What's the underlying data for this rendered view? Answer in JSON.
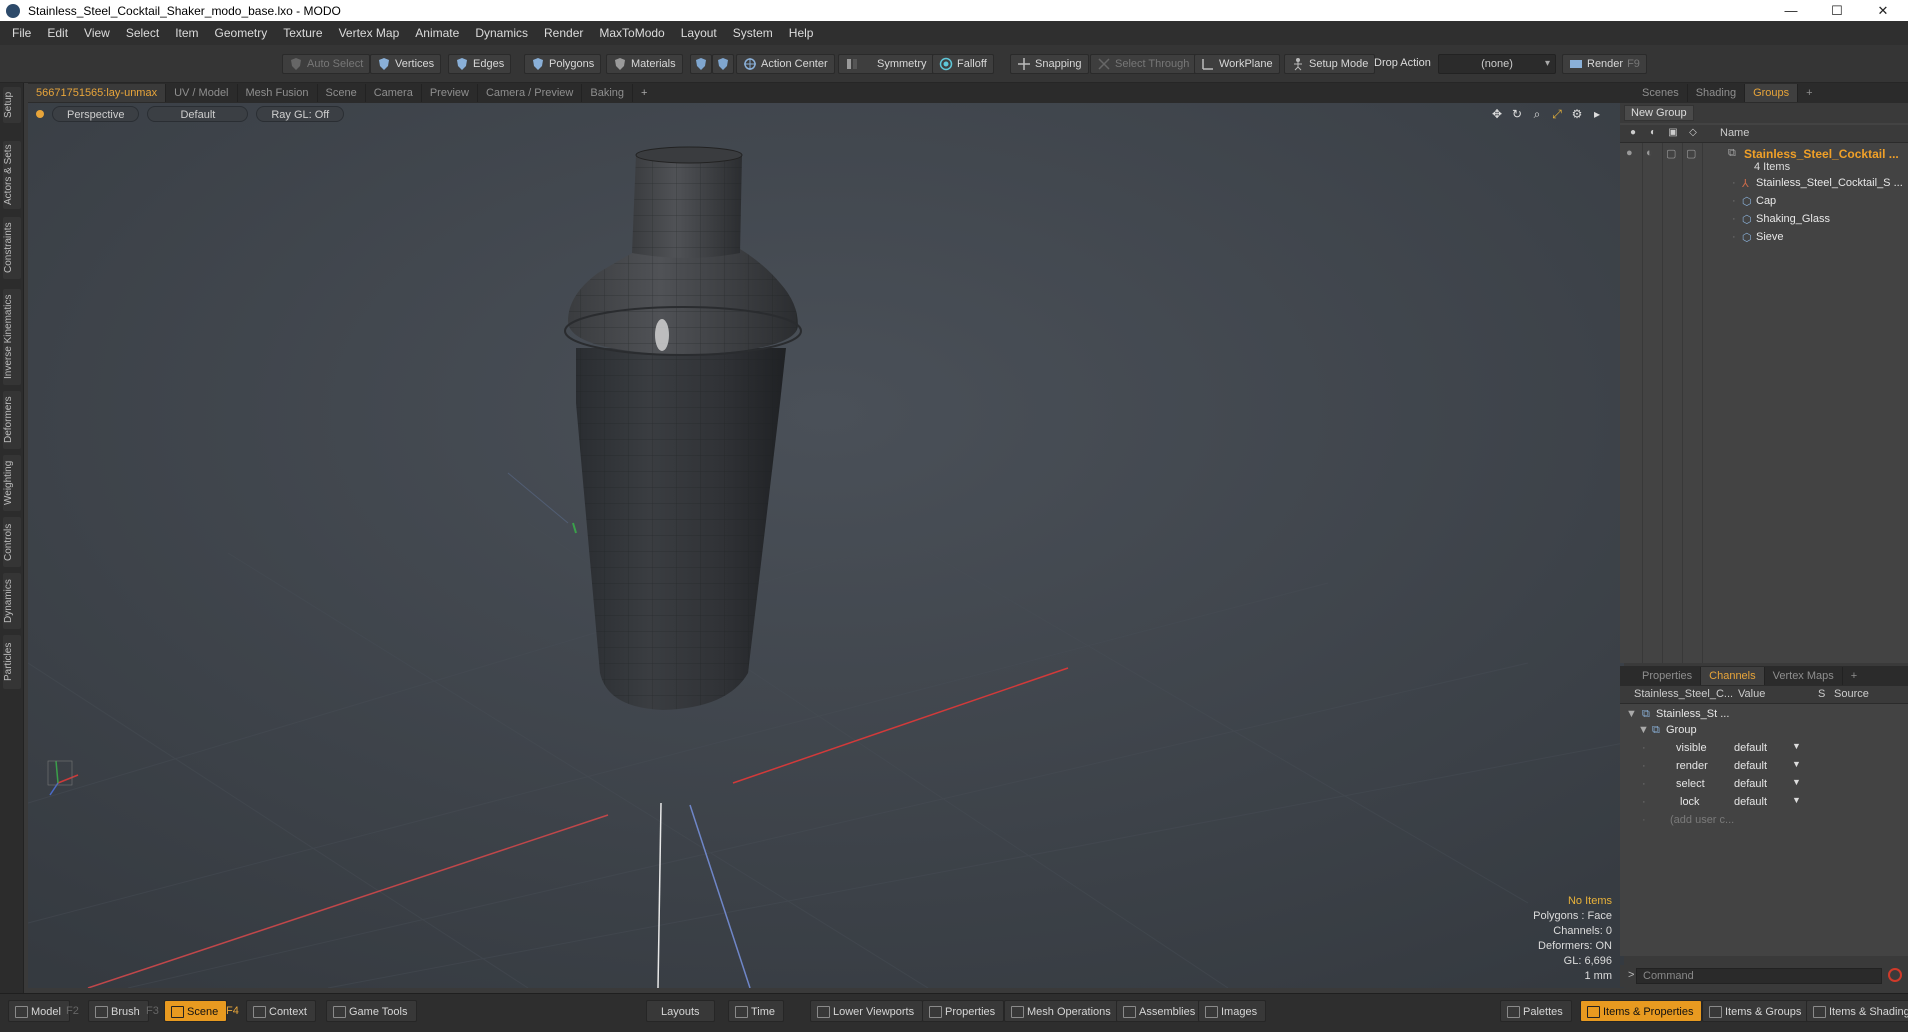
{
  "window": {
    "title": "Stainless_Steel_Cocktail_Shaker_modo_base.lxo - MODO",
    "minimize": "—",
    "maximize": "☐",
    "close": "✕"
  },
  "menu": [
    "File",
    "Edit",
    "View",
    "Select",
    "Item",
    "Geometry",
    "Texture",
    "Vertex Map",
    "Animate",
    "Dynamics",
    "Render",
    "MaxToModo",
    "Layout",
    "System",
    "Help"
  ],
  "toolbar": {
    "auto_select": "Auto Select",
    "vertices": "Vertices",
    "edges": "Edges",
    "polygons": "Polygons",
    "materials": "Materials",
    "action_center": "Action Center",
    "symmetry": "Symmetry",
    "falloff": "Falloff",
    "snapping": "Snapping",
    "select_through": "Select Through",
    "workplane": "WorkPlane",
    "setup_mode": "Setup Mode",
    "drop_action_label": "Drop Action",
    "drop_action_value": "(none)",
    "render": "Render",
    "render_key": "F9"
  },
  "left_tabs": [
    "Setup",
    "Actors & Sets",
    "Constraints",
    "Inverse Kinematics",
    "Deformers",
    "Weighting",
    "Controls",
    "Dynamics",
    "Particles"
  ],
  "viewport_tabs": [
    "56671751565:lay-unmax",
    "UV / Model",
    "Mesh Fusion",
    "Scene",
    "Camera",
    "Preview",
    "Camera / Preview",
    "Baking",
    "+"
  ],
  "viewport": {
    "view_mode": "Perspective",
    "shading": "Default",
    "raygl": "Ray GL: Off",
    "info": {
      "items": "No Items",
      "polygons": "Polygons : Face",
      "channels": "Channels: 0",
      "deformers": "Deformers: ON",
      "gl": "GL: 6,696",
      "unit": "1 mm"
    }
  },
  "scene_panel": {
    "tabs": [
      "Scenes",
      "Shading",
      "Groups",
      "+"
    ],
    "new_group": "New Group",
    "name_header": "Name",
    "group_name": "Stainless_Steel_Cocktail ...",
    "group_count": "4 Items",
    "items": [
      "Stainless_Steel_Cocktail_S ...",
      "Cap",
      "Shaking_Glass",
      "Sieve"
    ]
  },
  "channels_panel": {
    "tabs": [
      "Properties",
      "Channels",
      "Vertex Maps",
      "+"
    ],
    "headers": {
      "name": "Stainless_Steel_C...",
      "value": "Value",
      "s": "S",
      "source": "Source"
    },
    "root": "Stainless_St ...",
    "group": "Group",
    "rows": [
      {
        "name": "visible",
        "value": "default"
      },
      {
        "name": "render",
        "value": "default"
      },
      {
        "name": "select",
        "value": "default"
      },
      {
        "name": "lock",
        "value": "default"
      }
    ],
    "add_user": "(add user c..."
  },
  "command": {
    "prompt": ">",
    "placeholder": "Command"
  },
  "bottom": {
    "model": "Model",
    "model_key": "F2",
    "brush": "Brush",
    "brush_key": "F3",
    "scene": "Scene",
    "scene_key": "F4",
    "context": "Context",
    "game_tools": "Game Tools",
    "layouts": "Layouts",
    "time": "Time",
    "lower_viewports": "Lower Viewports",
    "properties": "Properties",
    "mesh_operations": "Mesh Operations",
    "assemblies": "Assemblies",
    "images": "Images",
    "palettes": "Palettes",
    "items_properties": "Items & Properties",
    "items_groups": "Items & Groups",
    "items_shading": "Items & Shading"
  },
  "colors": {
    "accent": "#e8a53a",
    "viewport_bg": "#3d434b",
    "panel_bg": "#434343"
  }
}
